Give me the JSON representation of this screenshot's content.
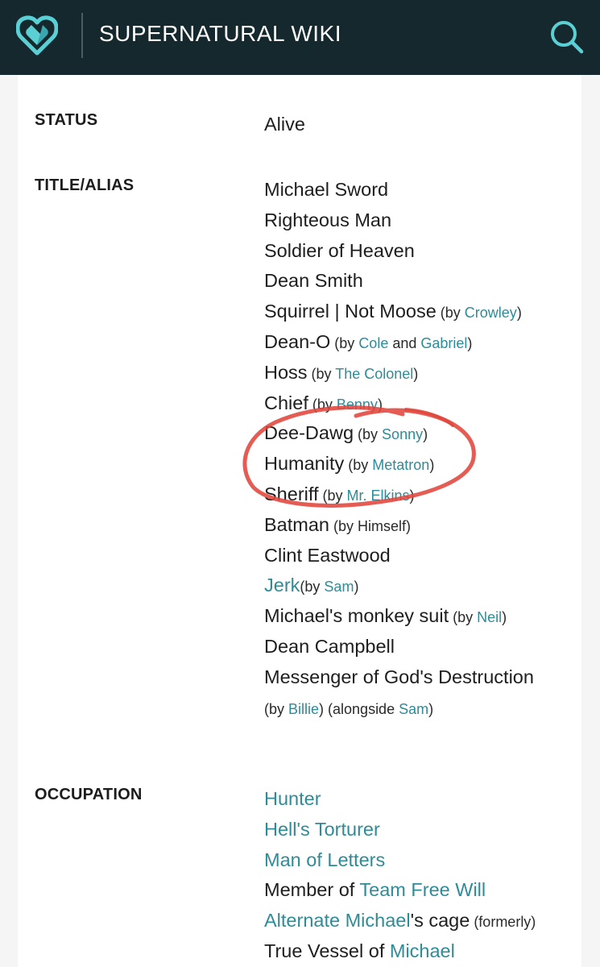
{
  "header": {
    "site_title": "SUPERNATURAL WIKI",
    "logo_icon": "fandom-heart-logo-icon",
    "search_icon": "search-icon",
    "bg_color": "#14282d",
    "accent_color": "#5bd0d4"
  },
  "status": {
    "label": "STATUS",
    "value": "Alive"
  },
  "title_alias": {
    "label": "TITLE/ALIAS",
    "rows": [
      {
        "text": "Michael Sword"
      },
      {
        "text": "Righteous Man"
      },
      {
        "text": "Soldier of Heaven"
      },
      {
        "text": "Dean Smith"
      },
      {
        "text": "Squirrel | Not Moose",
        "by_pre": " (by ",
        "link1": "Crowley",
        "post": ")"
      },
      {
        "text": "Dean-O",
        "by_pre": " (by ",
        "link1": "Cole",
        "mid": " and ",
        "link2": "Gabriel",
        "post": ")"
      },
      {
        "text": "Hoss",
        "by_pre": " (by ",
        "link1": "The Colonel",
        "post": ")"
      },
      {
        "text": "Chief",
        "by_pre": " (by ",
        "link1": "Benny",
        "post": ")"
      },
      {
        "text": "Dee-Dawg",
        "by_pre": " (by ",
        "link1": "Sonny",
        "post": ")"
      },
      {
        "text": "Humanity",
        "by_pre": " (by ",
        "link1": "Metatron",
        "post": ")"
      },
      {
        "text": "Sheriff",
        "by_pre": " (by ",
        "link1": "Mr. Elkins",
        "post": ")"
      },
      {
        "text": "Batman",
        "by_pre": " (by Himself)"
      },
      {
        "text": "Clint Eastwood"
      },
      {
        "link0": "Jerk",
        "by_pre": "(by ",
        "link1": "Sam",
        "post": ")"
      },
      {
        "text": "Michael's monkey suit",
        "by_pre": " (by ",
        "link1": "Neil",
        "post": ")"
      },
      {
        "text": "Dean Campbell"
      },
      {
        "text": "Messenger of God's Destruction"
      },
      {
        "by_pre": "(by ",
        "link1": "Billie",
        "mid": ") (alongside ",
        "link2": "Sam",
        "post": ")"
      }
    ]
  },
  "occupation": {
    "label": "OCCUPATION",
    "rows": [
      {
        "link0": "Hunter"
      },
      {
        "link0": "Hell's Torturer"
      },
      {
        "link0": "Man of Letters"
      },
      {
        "text": "Member of ",
        "link1": "Team Free Will"
      },
      {
        "link0": "Alternate Michael",
        "text_after": "'s cage",
        "small_after": " (formerly)"
      },
      {
        "text": "True Vessel of ",
        "link1": "Michael"
      }
    ]
  },
  "annotation": {
    "icon": "red-hand-drawn-circle-icon",
    "color": "#e0453b"
  }
}
